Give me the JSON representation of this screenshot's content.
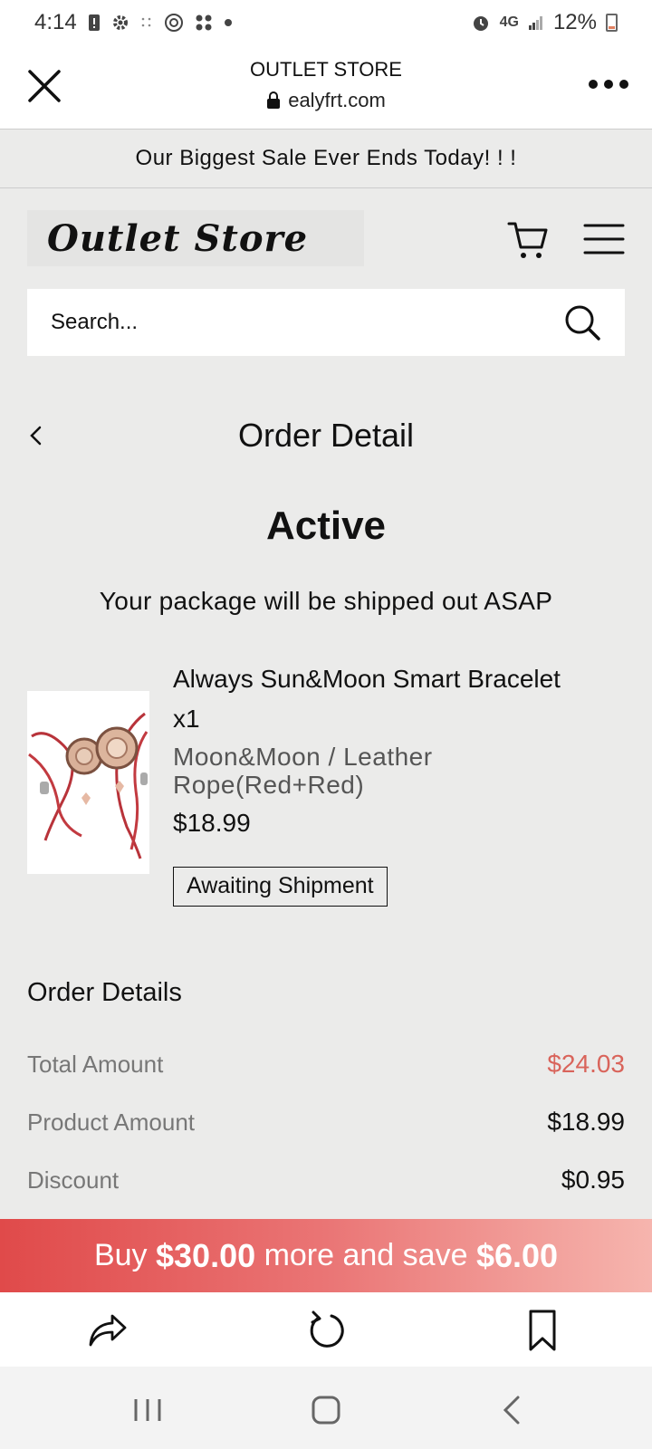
{
  "status_bar": {
    "time": "4:14",
    "network": "4G",
    "battery": "12%",
    "icons": [
      "alert-icon",
      "gear-icon",
      "dots-icon",
      "circle-b-icon",
      "apps-icon",
      "dot-icon",
      "alarm-icon",
      "signal-icon",
      "battery-icon"
    ]
  },
  "browser": {
    "title": "OUTLET STORE",
    "url": "ealyfrt.com"
  },
  "announcement": "Our Biggest Sale Ever Ends Today! ! !",
  "store": {
    "logo": "Outlet Store"
  },
  "search": {
    "placeholder": "Search..."
  },
  "page": {
    "title": "Order Detail"
  },
  "order": {
    "status": "Active",
    "status_message": "Your package will be shipped out ASAP",
    "item": {
      "name": "Always Sun&Moon Smart Bracelet",
      "quantity": "x1",
      "variant": "Moon&Moon / Leather Rope(Red+Red)",
      "price": "$18.99",
      "shipment_status": "Awaiting Shipment"
    },
    "details_title": "Order Details",
    "rows": [
      {
        "label": "Total Amount",
        "value": "$24.03"
      },
      {
        "label": "Product Amount",
        "value": "$18.99"
      },
      {
        "label": "Discount",
        "value": "$0.95"
      }
    ]
  },
  "promo": {
    "prefix": "Buy",
    "amount": "$30.00",
    "middle": "more and save",
    "save": "$6.00"
  },
  "colors": {
    "accent_price": "#d9645b",
    "promo_start": "#e04a4a",
    "promo_end": "#f6b5ae",
    "background": "#ebebea"
  }
}
